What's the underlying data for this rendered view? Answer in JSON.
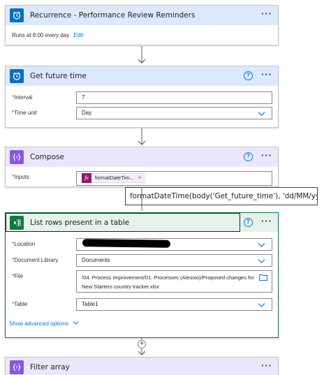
{
  "cards": {
    "recurrence": {
      "title": "Recurrence - Performance Review Reminders",
      "summary": "Runs at 8:00 every day",
      "edit_label": "Edit"
    },
    "get_future_time": {
      "title": "Get future time",
      "fields": [
        {
          "label": "Interval",
          "value": "7"
        },
        {
          "label": "Time unit",
          "value": "Day"
        }
      ]
    },
    "compose": {
      "title": "Compose",
      "inputs_label": "Inputs",
      "token_label": "formatDateTim...",
      "token_remove": "×"
    },
    "list_rows": {
      "title": "List rows present in a table",
      "fields": [
        {
          "label": "Location",
          "value": ""
        },
        {
          "label": "Document Library",
          "value": "Documents"
        },
        {
          "label": "File",
          "value_line1": "/04. Process Improvement/01. Processes (Alessio)/Proposed changes for",
          "value_line2": "New Starters country tracker.xlsx"
        },
        {
          "label": "Table",
          "value": "Table1"
        }
      ],
      "advanced_label": "Show advanced options"
    },
    "filter_array": {
      "title": "Filter array"
    }
  },
  "tooltip": "formatDateTime(body('Get_future_time'), 'dd/MM/yyyy')",
  "insert_step": "+",
  "more_label": "···",
  "help_label": "?",
  "required_marker": "*",
  "icons": {
    "recurrence": "alarm-clock-icon",
    "get_future_time": "alarm-clock-icon",
    "compose": "compose-braces-icon",
    "list_rows": "excel-icon",
    "filter_array": "filter-braces-icon"
  },
  "colors": {
    "blue_tile": "#0f6cbd",
    "blue_header": "#dce8fb",
    "purple_tile": "#8659e0",
    "purple_header": "#ece6fb",
    "green_tile": "#107c41",
    "green_header": "#e6f1ea",
    "expression": "#8c1b6a",
    "link": "#0078d4",
    "required": "#d13438"
  }
}
